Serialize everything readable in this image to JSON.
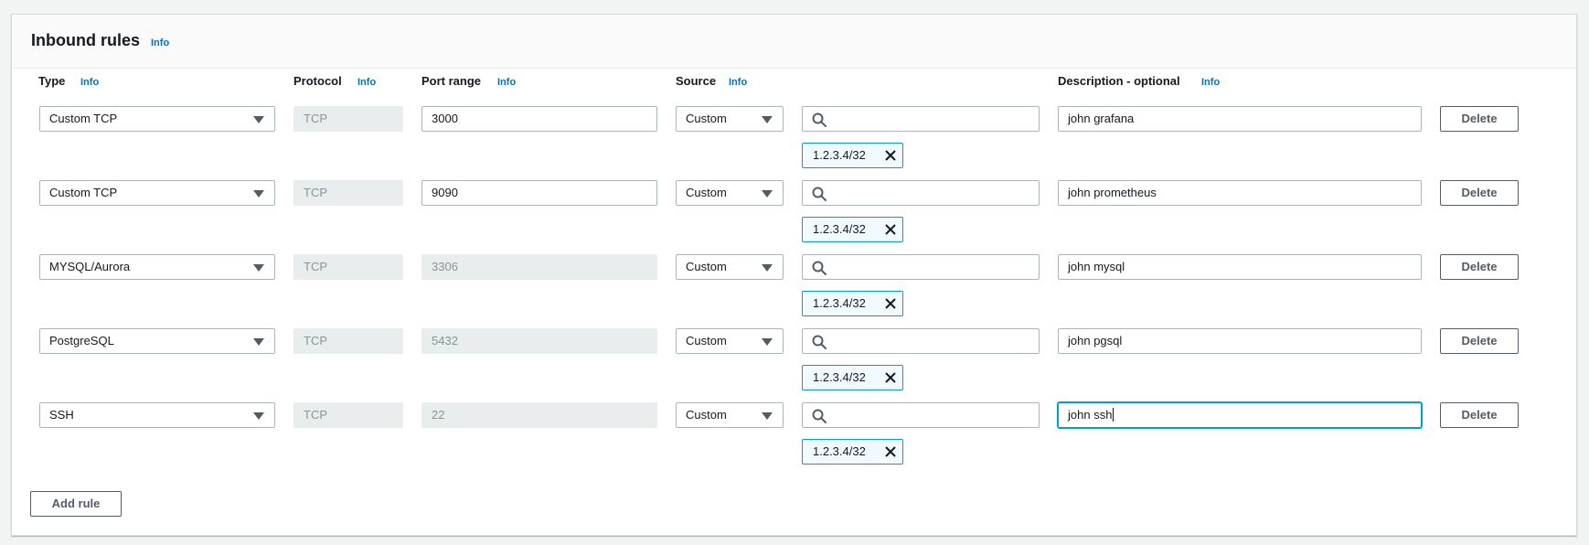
{
  "section": {
    "title": "Inbound rules",
    "info": "Info"
  },
  "columns": {
    "type": "Type",
    "protocol": "Protocol",
    "port_range": "Port range",
    "source": "Source",
    "description": "Description - optional",
    "info": "Info"
  },
  "rules": [
    {
      "type": "Custom TCP",
      "protocol": "TCP",
      "port": "3000",
      "port_editable": true,
      "source": "Custom",
      "cidr": "1.2.3.4/32",
      "description": "john grafana",
      "delete": "Delete"
    },
    {
      "type": "Custom TCP",
      "protocol": "TCP",
      "port": "9090",
      "port_editable": true,
      "source": "Custom",
      "cidr": "1.2.3.4/32",
      "description": "john prometheus",
      "delete": "Delete"
    },
    {
      "type": "MYSQL/Aurora",
      "protocol": "TCP",
      "port": "3306",
      "port_editable": false,
      "source": "Custom",
      "cidr": "1.2.3.4/32",
      "description": "john mysql",
      "delete": "Delete"
    },
    {
      "type": "PostgreSQL",
      "protocol": "TCP",
      "port": "5432",
      "port_editable": false,
      "source": "Custom",
      "cidr": "1.2.3.4/32",
      "description": "john pgsql",
      "delete": "Delete"
    },
    {
      "type": "SSH",
      "protocol": "TCP",
      "port": "22",
      "port_editable": false,
      "source": "Custom",
      "cidr": "1.2.3.4/32",
      "description": "john ssh",
      "delete": "Delete",
      "focused": true
    }
  ],
  "add_rule_label": "Add rule",
  "colors": {
    "link": "#0073bb",
    "token_border": "#00a1c9",
    "token_bg": "#f1faff",
    "disabled_bg": "#eaeded"
  },
  "icons": {
    "dropdown": "caret-down-icon",
    "search": "search-icon",
    "remove": "close-icon"
  }
}
